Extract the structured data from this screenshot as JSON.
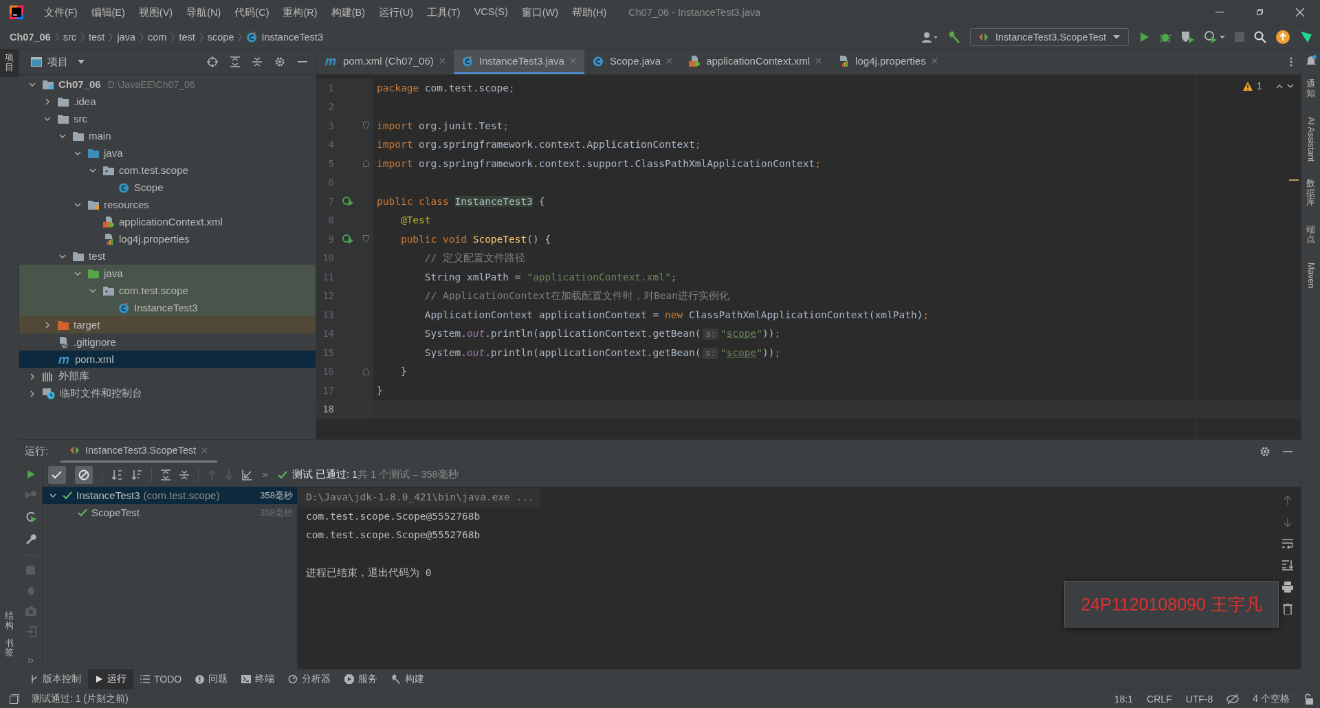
{
  "window": {
    "title": "Ch07_06 - InstanceTest3.java"
  },
  "menu": [
    "文件(F)",
    "编辑(E)",
    "视图(V)",
    "导航(N)",
    "代码(C)",
    "重构(R)",
    "构建(B)",
    "运行(U)",
    "工具(T)",
    "VCS(S)",
    "窗口(W)",
    "帮助(H)"
  ],
  "breadcrumbs": [
    {
      "label": "Ch07_06",
      "kind": "module"
    },
    {
      "label": "src",
      "kind": "plain"
    },
    {
      "label": "test",
      "kind": "plain"
    },
    {
      "label": "java",
      "kind": "plain"
    },
    {
      "label": "com",
      "kind": "plain"
    },
    {
      "label": "test",
      "kind": "plain"
    },
    {
      "label": "scope",
      "kind": "plain"
    },
    {
      "label": "InstanceTest3",
      "kind": "test-class"
    }
  ],
  "run_config": {
    "label": "InstanceTest3.ScopeTest"
  },
  "left_strip": [
    {
      "label": "项目",
      "selected": true
    },
    {
      "label": "结构",
      "selected": false
    },
    {
      "label": "书签",
      "selected": false
    }
  ],
  "right_strip": [
    {
      "label": "通知",
      "kind": "cjk"
    },
    {
      "label": "AI Assistant",
      "kind": "latin"
    },
    {
      "label": "数据库",
      "kind": "cjk"
    },
    {
      "label": "端点",
      "kind": "cjk"
    },
    {
      "label": "Maven",
      "kind": "latin"
    }
  ],
  "project_panel": {
    "title": "项目",
    "tree": [
      {
        "label": "Ch07_06",
        "hint": "D:\\JavaEE\\Ch07_06",
        "kind": "module",
        "expanded": true,
        "selected": false,
        "test_scope": false,
        "children": [
          {
            "label": ".idea",
            "kind": "folder",
            "expanded": false,
            "selected": false,
            "test_scope": false
          },
          {
            "label": "src",
            "kind": "folder",
            "expanded": true,
            "selected": false,
            "test_scope": false,
            "children": [
              {
                "label": "main",
                "kind": "folder",
                "expanded": true,
                "selected": false,
                "test_scope": false,
                "children": [
                  {
                    "label": "java",
                    "kind": "source-folder",
                    "expanded": true,
                    "selected": false,
                    "test_scope": false,
                    "children": [
                      {
                        "label": "com.test.scope",
                        "kind": "package",
                        "expanded": true,
                        "selected": false,
                        "test_scope": false,
                        "children": [
                          {
                            "label": "Scope",
                            "kind": "class",
                            "selected": false,
                            "test_scope": false
                          }
                        ]
                      }
                    ]
                  },
                  {
                    "label": "resources",
                    "kind": "resources-folder",
                    "expanded": true,
                    "selected": false,
                    "test_scope": false,
                    "children": [
                      {
                        "label": "applicationContext.xml",
                        "kind": "xml",
                        "selected": false,
                        "test_scope": false
                      },
                      {
                        "label": "log4j.properties",
                        "kind": "properties",
                        "selected": false,
                        "test_scope": false
                      }
                    ]
                  }
                ]
              },
              {
                "label": "test",
                "kind": "folder",
                "expanded": true,
                "selected": false,
                "test_scope": false,
                "children": [
                  {
                    "label": "java",
                    "kind": "test-folder",
                    "expanded": true,
                    "selected": false,
                    "test_scope": true,
                    "children": [
                      {
                        "label": "com.test.scope",
                        "kind": "package",
                        "expanded": true,
                        "selected": false,
                        "test_scope": true,
                        "children": [
                          {
                            "label": "InstanceTest3",
                            "kind": "test-class",
                            "selected": false,
                            "test_scope": true
                          }
                        ]
                      }
                    ]
                  }
                ]
              }
            ]
          },
          {
            "label": "target",
            "kind": "excluded-folder",
            "expanded": false,
            "selected": false,
            "test_scope": false
          },
          {
            "label": ".gitignore",
            "kind": "ignore",
            "selected": false,
            "test_scope": false
          },
          {
            "label": "pom.xml",
            "kind": "maven",
            "selected": true,
            "test_scope": false
          }
        ]
      },
      {
        "label": "外部库",
        "kind": "library",
        "expanded": false,
        "selected": false,
        "test_scope": false
      },
      {
        "label": "临时文件和控制台",
        "kind": "scratches",
        "expanded": false,
        "selected": false,
        "test_scope": false
      }
    ]
  },
  "editor_tabs": [
    {
      "label": "pom.xml (Ch07_06)",
      "kind": "maven",
      "selected": false
    },
    {
      "label": "InstanceTest3.java",
      "kind": "test-class",
      "selected": true
    },
    {
      "label": "Scope.java",
      "kind": "class",
      "selected": false
    },
    {
      "label": "applicationContext.xml",
      "kind": "xml",
      "selected": false
    },
    {
      "label": "log4j.properties",
      "kind": "properties",
      "selected": false
    }
  ],
  "editor": {
    "warnings": "1",
    "lines": [
      {
        "number": "1",
        "current": false,
        "runnable": false,
        "fold_start": false,
        "fold_end": false,
        "tokens": [
          {
            "kind": "kw",
            "text": "package"
          },
          {
            "kind": "plain",
            "text": " com.test.scope"
          },
          {
            "kind": "punct",
            "text": ";"
          }
        ]
      },
      {
        "number": "2",
        "current": false,
        "runnable": false,
        "fold_start": false,
        "fold_end": false
      },
      {
        "number": "3",
        "current": false,
        "runnable": false,
        "fold_start": true,
        "fold_end": false,
        "tokens": [
          {
            "kind": "kw",
            "text": "import"
          },
          {
            "kind": "plain",
            "text": " org.junit.Test"
          },
          {
            "kind": "punct",
            "text": ";"
          }
        ]
      },
      {
        "number": "4",
        "current": false,
        "runnable": false,
        "fold_start": false,
        "fold_end": false,
        "tokens": [
          {
            "kind": "kw",
            "text": "import"
          },
          {
            "kind": "plain",
            "text": " org.springframework.context.ApplicationContext"
          },
          {
            "kind": "punct",
            "text": ";"
          }
        ]
      },
      {
        "number": "5",
        "current": false,
        "runnable": false,
        "fold_start": false,
        "fold_end": true,
        "tokens": [
          {
            "kind": "kw",
            "text": "import"
          },
          {
            "kind": "plain",
            "text": " org.springframework.context.support.ClassPathXmlApplicationContext"
          },
          {
            "kind": "punct",
            "text": ";"
          }
        ]
      },
      {
        "number": "6",
        "current": false,
        "runnable": false,
        "fold_start": false,
        "fold_end": false
      },
      {
        "number": "7",
        "current": false,
        "runnable": true,
        "fold_start": false,
        "fold_end": false,
        "tokens": [
          {
            "kind": "kw",
            "text": "public class "
          },
          {
            "kind": "highlight",
            "text": "InstanceTest3"
          },
          {
            "kind": "plain",
            "text": " {"
          }
        ],
        "children": [
          {
            "number": "8",
            "current": false,
            "runnable": false,
            "fold_start": false,
            "fold_end": false,
            "tokens": [
              {
                "kind": "ann",
                "text": "@Test"
              }
            ]
          },
          {
            "number": "9",
            "current": false,
            "runnable": true,
            "fold_start": true,
            "fold_end": false,
            "tokens": [
              {
                "kind": "kw",
                "text": "public void "
              },
              {
                "kind": "fn",
                "text": "ScopeTest"
              },
              {
                "kind": "plain",
                "text": "() {"
              }
            ],
            "children": [
              {
                "number": "10",
                "current": false,
                "runnable": false,
                "fold_start": false,
                "fold_end": false,
                "tokens": [
                  {
                    "kind": "cmt",
                    "text": "// 定义配置文件路径"
                  }
                ]
              },
              {
                "number": "11",
                "current": false,
                "runnable": false,
                "fold_start": false,
                "fold_end": false,
                "tokens": [
                  {
                    "kind": "plain",
                    "text": "String xmlPath = "
                  },
                  {
                    "kind": "str",
                    "text": "\"applicationContext.xml\""
                  },
                  {
                    "kind": "punct",
                    "text": ";"
                  }
                ]
              },
              {
                "number": "12",
                "current": false,
                "runnable": false,
                "fold_start": false,
                "fold_end": false,
                "tokens": [
                  {
                    "kind": "cmt",
                    "text": "// ApplicationContext在加载配置文件时，对Bean进行实例化"
                  }
                ]
              },
              {
                "number": "13",
                "current": false,
                "runnable": false,
                "fold_start": false,
                "fold_end": false,
                "tokens": [
                  {
                    "kind": "plain",
                    "text": "ApplicationContext applicationContext = "
                  },
                  {
                    "kind": "kw",
                    "text": "new"
                  },
                  {
                    "kind": "plain",
                    "text": " ClassPathXmlApplicationContext(xmlPath)"
                  },
                  {
                    "kind": "punct",
                    "text": ";"
                  }
                ]
              },
              {
                "number": "14",
                "current": false,
                "runnable": false,
                "fold_start": false,
                "fold_end": false,
                "tokens": [
                  {
                    "kind": "plain",
                    "text": "System."
                  },
                  {
                    "kind": "field",
                    "text": "out"
                  },
                  {
                    "kind": "plain",
                    "text": ".println(applicationContext.getBean("
                  },
                  {
                    "kind": "hint",
                    "text": "s:"
                  },
                  {
                    "kind": "str",
                    "text": "\""
                  },
                  {
                    "kind": "link",
                    "text": "scope"
                  },
                  {
                    "kind": "str",
                    "text": "\""
                  },
                  {
                    "kind": "plain",
                    "text": "))"
                  },
                  {
                    "kind": "punct",
                    "text": ";"
                  }
                ]
              },
              {
                "number": "15",
                "current": false,
                "runnable": false,
                "fold_start": false,
                "fold_end": false,
                "tokens": [
                  {
                    "kind": "plain",
                    "text": "System."
                  },
                  {
                    "kind": "field",
                    "text": "out"
                  },
                  {
                    "kind": "plain",
                    "text": ".println(applicationContext.getBean("
                  },
                  {
                    "kind": "hint",
                    "text": "s:"
                  },
                  {
                    "kind": "str",
                    "text": "\""
                  },
                  {
                    "kind": "link",
                    "text": "scope"
                  },
                  {
                    "kind": "str",
                    "text": "\""
                  },
                  {
                    "kind": "plain",
                    "text": "))"
                  },
                  {
                    "kind": "punct",
                    "text": ";"
                  }
                ]
              }
            ]
          },
          {
            "number": "16",
            "current": false,
            "runnable": false,
            "fold_start": false,
            "fold_end": true,
            "tokens": [
              {
                "kind": "plain",
                "text": "}"
              }
            ]
          }
        ]
      },
      {
        "number": "17",
        "current": false,
        "runnable": false,
        "fold_start": false,
        "fold_end": false,
        "tokens": [
          {
            "kind": "plain",
            "text": "}"
          }
        ]
      },
      {
        "number": "18",
        "current": true,
        "runnable": false,
        "fold_start": false,
        "fold_end": false
      }
    ]
  },
  "run_panel": {
    "label": "运行:",
    "tab": "InstanceTest3.ScopeTest",
    "passed": "测试 已通过: 1",
    "summary": "共 1 个测试 – 358毫秒",
    "tests": [
      {
        "name": "InstanceTest3",
        "package": "(com.test.scope)",
        "time": "358毫秒",
        "passed": true,
        "selected": true,
        "children": [
          {
            "name": "ScopeTest",
            "time": "358毫秒",
            "passed": true,
            "selected": false
          }
        ]
      }
    ],
    "console": [
      {
        "text": "D:\\Java\\jdk-1.8.0_421\\bin\\java.exe ...",
        "kind": "command"
      },
      {
        "text": "com.test.scope.Scope@5552768b",
        "kind": "output"
      },
      {
        "text": "com.test.scope.Scope@5552768b",
        "kind": "output"
      },
      {
        "kind": "blank"
      },
      {
        "text": "进程已结束，退出代码为 0",
        "kind": "output"
      }
    ]
  },
  "tool_tabs": [
    {
      "label": "版本控制",
      "kind": "vcs",
      "selected": false
    },
    {
      "label": "运行",
      "kind": "run",
      "selected": true
    },
    {
      "label": "TODO",
      "kind": "todo",
      "selected": false
    },
    {
      "label": "问题",
      "kind": "problems",
      "selected": false
    },
    {
      "label": "终端",
      "kind": "terminal",
      "selected": false
    },
    {
      "label": "分析器",
      "kind": "profiler",
      "selected": false
    },
    {
      "label": "服务",
      "kind": "services",
      "selected": false
    },
    {
      "label": "构建",
      "kind": "build",
      "selected": false
    }
  ],
  "status_bar": {
    "message": "测试通过: 1 (片刻之前)",
    "position": "18:1",
    "line_separator": "CRLF",
    "encoding": "UTF-8",
    "indent": "4 个空格"
  },
  "overlay_label": "24P1120108090 王宇凡"
}
